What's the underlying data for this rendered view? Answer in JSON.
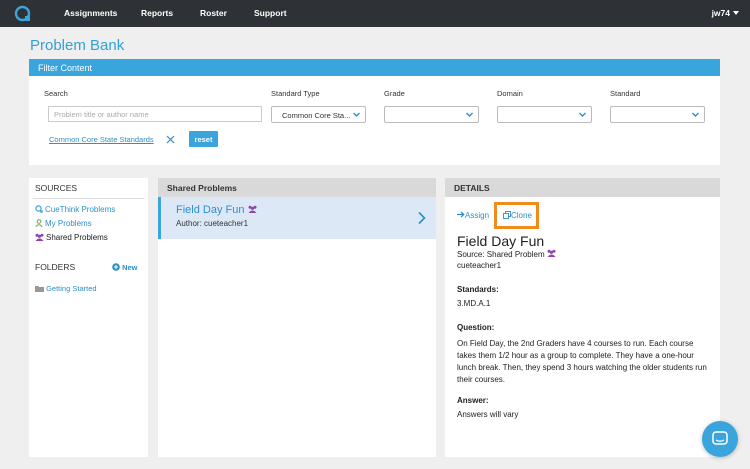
{
  "nav": {
    "items": [
      "Assignments",
      "Reports",
      "Roster",
      "Support"
    ],
    "user": "jw74"
  },
  "page": {
    "title": "Problem Bank"
  },
  "filter": {
    "header": "Filter Content",
    "search_label": "Search",
    "search_placeholder": "Problem title or author name",
    "standard_type_label": "Standard Type",
    "standard_type_value": "Common Core Sta...",
    "grade_label": "Grade",
    "domain_label": "Domain",
    "standard_label": "Standard",
    "active_chip": "Common Core State Standards",
    "reset_label": "reset"
  },
  "sources": {
    "title": "SOURCES",
    "items": [
      "CueThink Problems",
      "My Problems",
      "Shared Problems"
    ],
    "folders_title": "FOLDERS",
    "new_label": "New",
    "folders": [
      "Getting Started"
    ]
  },
  "shared": {
    "header": "Shared Problems",
    "problem": {
      "title": "Field Day Fun",
      "author": "Author: cueteacher1"
    }
  },
  "details": {
    "header": "DETAILS",
    "assign_label": "Assign",
    "clone_label": "Clone",
    "title": "Field Day Fun",
    "source": "Source: Shared Problem",
    "author": "cueteacher1",
    "standards_label": "Standards:",
    "standards_value": "3.MD.A.1",
    "question_label": "Question:",
    "question_text": "On Field Day, the 2nd Graders have 4 courses to run. Each course takes them 1/2 hour as a group to complete. They have a one-hour lunch break. Then, they spend 3 hours watching the older students run their courses.",
    "answer_label": "Answer:",
    "answer_text": "Answers will vary"
  },
  "colors": {
    "accent": "#3aa4dd",
    "link": "#2d8fc9",
    "nav_bg": "#2e3135",
    "highlight": "#f08c1c",
    "shared_icon": "#8e44ad",
    "my_icon": "#6aa84f"
  },
  "icons": {
    "logo": "cuethink-logo-icon",
    "select": "chevron-down-icon",
    "remove": "close-icon",
    "cuethink_source": "magnifier-icon",
    "my_source": "person-icon",
    "shared_source": "group-icon",
    "folder": "folder-icon",
    "add": "plus-circle-icon",
    "open": "chevron-right-icon",
    "assign": "arrow-right-icon",
    "clone": "copy-icon",
    "chat": "chat-bubble-icon"
  }
}
